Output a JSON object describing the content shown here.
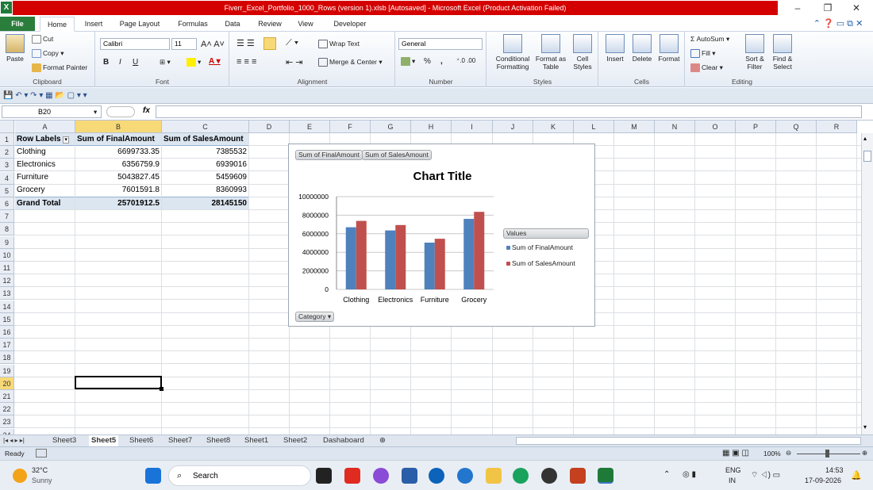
{
  "window": {
    "title": "Fiverr_Excel_Portfolio_1000_Rows (version 1).xlsb [Autosaved] - Microsoft Excel (Product Activation Failed)",
    "app_icon": "X"
  },
  "ribbon_tabs": [
    "File",
    "Home",
    "Insert",
    "Page Layout",
    "Formulas",
    "Data",
    "Review",
    "View",
    "Developer"
  ],
  "active_tab": "Home",
  "clipboard": {
    "paste": "Paste",
    "cut": "Cut",
    "copy": "Copy",
    "format_painter": "Format Painter",
    "label": "Clipboard"
  },
  "font": {
    "name": "Calibri",
    "size": "11",
    "bold": "B",
    "italic": "I",
    "underline": "U",
    "label": "Font"
  },
  "alignment": {
    "wrap": "Wrap Text",
    "merge": "Merge & Center",
    "label": "Alignment"
  },
  "number": {
    "format": "General",
    "percent": "%",
    "comma": ",",
    "label": "Number"
  },
  "styles": {
    "conditional": "Conditional Formatting",
    "format_table": "Format as Table",
    "cell_styles": "Cell Styles",
    "label": "Styles"
  },
  "cells": {
    "insert": "Insert",
    "delete": "Delete",
    "format": "Format",
    "label": "Cells"
  },
  "editing": {
    "autosum": "AutoSum",
    "fill": "Fill",
    "clear": "Clear",
    "sort": "Sort & Filter",
    "find": "Find & Select",
    "label": "Editing"
  },
  "formula_bar": {
    "name_box": "B20",
    "fx": "fx",
    "value": ""
  },
  "columns": [
    "A",
    "B",
    "C",
    "D",
    "E",
    "F",
    "G",
    "H",
    "I",
    "J",
    "K",
    "L",
    "M",
    "N",
    "O",
    "P",
    "Q",
    "R"
  ],
  "rows": [
    "1",
    "2",
    "3",
    "4",
    "5",
    "6",
    "7",
    "8",
    "9",
    "10",
    "11",
    "12",
    "13",
    "14",
    "15",
    "16",
    "17",
    "18",
    "19",
    "20",
    "21",
    "22",
    "23",
    "24"
  ],
  "pivot": {
    "headers": [
      "Row Labels",
      "Sum of FinalAmount",
      "Sum of SalesAmount"
    ],
    "rows": [
      {
        "label": "Clothing",
        "final": "6699733.35",
        "sales": "7385532"
      },
      {
        "label": "Electronics",
        "final": "6356759.9",
        "sales": "6939016"
      },
      {
        "label": "Furniture",
        "final": "5043827.45",
        "sales": "5459609"
      },
      {
        "label": "Grocery",
        "final": "7601591.8",
        "sales": "8360993"
      }
    ],
    "total": {
      "label": "Grand Total",
      "final": "25701912.5",
      "sales": "28145150"
    }
  },
  "chart_data": {
    "type": "bar",
    "title": "Chart Title",
    "categories": [
      "Clothing",
      "Electronics",
      "Furniture",
      "Grocery"
    ],
    "series": [
      {
        "name": "Sum of FinalAmount",
        "values": [
          6699733.35,
          6356759.9,
          5043827.45,
          7601591.8
        ],
        "color": "#4f81bd"
      },
      {
        "name": "Sum of SalesAmount",
        "values": [
          7385532,
          6939016,
          5459609,
          8360993
        ],
        "color": "#c0504d"
      }
    ],
    "ylim": [
      0,
      10000000
    ],
    "yticks": [
      "10000000",
      "8000000",
      "6000000",
      "4000000",
      "2000000",
      "0"
    ],
    "legend_title": "Values",
    "legend": "right",
    "field_buttons": [
      "Sum of FinalAmount",
      "Sum of SalesAmount"
    ],
    "axis_button": "Category"
  },
  "sheets": [
    "Sheet3",
    "Sheet5",
    "Sheet6",
    "Sheet7",
    "Sheet8",
    "Sheet1",
    "Sheet2",
    "Dashaboard"
  ],
  "active_sheet": "Sheet5",
  "status": {
    "ready": "Ready",
    "zoom": "100%"
  },
  "taskbar": {
    "temp": "32°C",
    "weather": "Sunny",
    "search": "Search",
    "lang": "ENG",
    "region": "IN",
    "time": "14:53",
    "date": "17-09-2026"
  }
}
